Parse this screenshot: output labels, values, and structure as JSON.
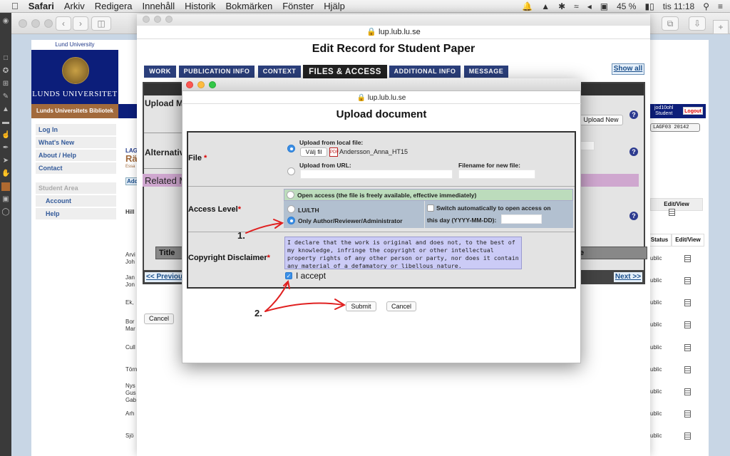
{
  "menubar": {
    "apple": "",
    "app": "Safari",
    "items": [
      "Arkiv",
      "Redigera",
      "Innehåll",
      "Historik",
      "Bokmärken",
      "Fönster",
      "Hjälp"
    ],
    "battery": "45 %",
    "clock": "tis 11:18"
  },
  "back_page": {
    "university_caption": "Lund University",
    "university_name": "LUNDS UNIVERSITET",
    "library_name": "Lunds Universitets Bibliotek",
    "sidebar": {
      "items": [
        "Log In",
        "What's New",
        "About / Help",
        "Contact"
      ],
      "section": "Student Area",
      "sub_items": [
        "Account",
        "Help"
      ]
    },
    "user": {
      "id": "jod10ohl",
      "role": "Student",
      "logout": "Logout"
    },
    "term_select": "LAGF03 20142",
    "fragments": {
      "code": "LAG",
      "title": "Rä",
      "subtitle": "Essa",
      "add": "Add",
      "row": "Hill"
    },
    "table": {
      "headers": [
        "Status",
        "Edit/View"
      ],
      "names": [
        "Arvi Joh",
        "Jan Jon",
        "Ek,",
        "Bor Mar",
        "Cull",
        "Törn",
        "Nys Gus Gab",
        "Arh",
        "Sjö"
      ],
      "status": "ublic"
    },
    "cancel": "Cancel"
  },
  "edit_window": {
    "url": "lup.lub.lu.se",
    "title": "Edit Record for Student Paper",
    "tabs": [
      "WORK",
      "PUBLICATION INFO",
      "CONTEXT",
      "FILES & ACCESS",
      "ADDITIONAL INFO",
      "MESSAGE"
    ],
    "active_tab": "FILES & ACCESS",
    "show_all": "Show all",
    "labels": {
      "upload": "Upload Ma",
      "alternative": "Alternativ",
      "related": "Related M",
      "title_col": "Title",
      "title_col_end": "e"
    },
    "upload_new": "Upload New",
    "prev": "<< Previou",
    "next": "Next >>",
    "edit_view_header": "Edit/View"
  },
  "dialog": {
    "url": "lup.lub.lu.se",
    "title": "Upload document",
    "file": {
      "label": "File",
      "required_mark": "*",
      "local_label": "Upload from local file:",
      "choose_button": "Välj fil",
      "chosen_file": "Andersson_Anna_HT15",
      "url_label": "Upload from URL:",
      "url_value": "",
      "newname_label": "Filename for new file:",
      "newname_value": "",
      "selected": "local"
    },
    "access": {
      "label": "Access Level",
      "required_mark": "*",
      "open": "Open access (the file is freely available, effective immediately)",
      "lu": "LU/LTH",
      "only": "Only Author/Reviewer/Administrator",
      "selected": "only",
      "switch_label": "Switch automatically to open access on",
      "date_label": "this day (YYYY-MM-DD):",
      "date_value": "",
      "switch_checked": false
    },
    "copyright": {
      "label": "Copyright Disclaimer",
      "required_mark": "*",
      "text": "I declare that the work is original and does not, to the best of my knowledge, infringe the copyright or other intellectual property rights of any other person or party, nor does it contain any material of a defamatory or libellous nature.",
      "accept_label": "I accept",
      "accepted": true
    },
    "submit": "Submit",
    "cancel": "Cancel"
  },
  "annotations": {
    "step1": "1.",
    "step2": "2.",
    "color": "#e02020"
  }
}
